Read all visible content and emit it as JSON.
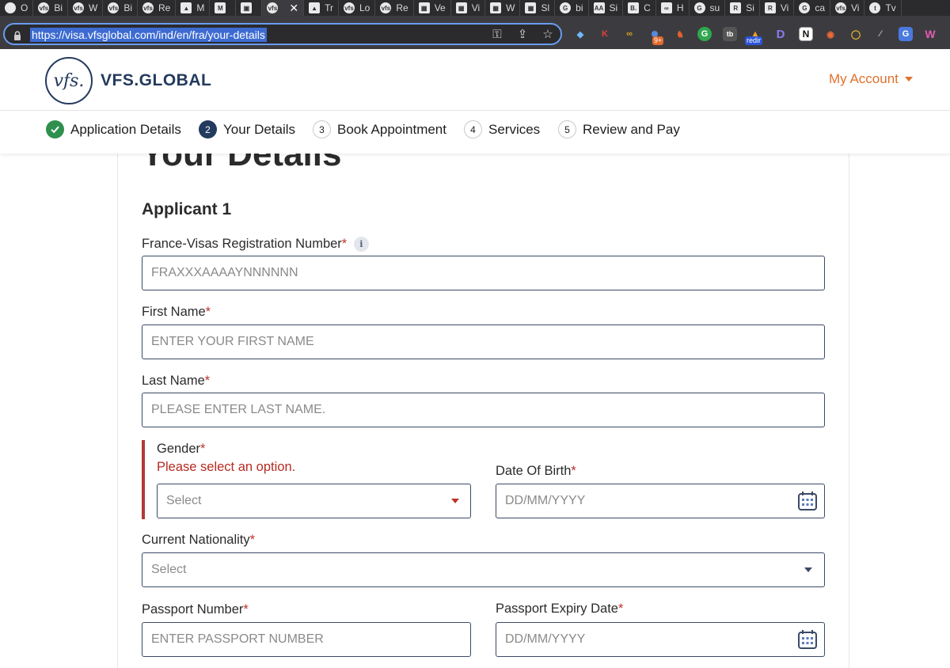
{
  "browser": {
    "tabs": [
      {
        "label": "O",
        "fav": "",
        "kind": "round"
      },
      {
        "label": "Bi",
        "fav": "vfs",
        "kind": "round"
      },
      {
        "label": "W",
        "fav": "vfs",
        "kind": "round"
      },
      {
        "label": "Bi",
        "fav": "vfs",
        "kind": "round"
      },
      {
        "label": "Re",
        "fav": "vfs",
        "kind": "round"
      },
      {
        "label": "M",
        "fav": "▲",
        "kind": "sq"
      },
      {
        "label": "",
        "fav": "M",
        "kind": "sq"
      },
      {
        "label": "",
        "fav": "▣",
        "kind": "sq"
      },
      {
        "label": "",
        "fav": "vfs",
        "kind": "round",
        "active": true
      },
      {
        "label": "Tr",
        "fav": "▲",
        "kind": "sq"
      },
      {
        "label": "Lo",
        "fav": "vfs",
        "kind": "round"
      },
      {
        "label": "Re",
        "fav": "vfs",
        "kind": "round"
      },
      {
        "label": "Ve",
        "fav": "▦",
        "kind": "sq"
      },
      {
        "label": "Vi",
        "fav": "▦",
        "kind": "sq"
      },
      {
        "label": "W",
        "fav": "▦",
        "kind": "sq"
      },
      {
        "label": "Sl",
        "fav": "▦",
        "kind": "sq"
      },
      {
        "label": "bi",
        "fav": "G",
        "kind": "round"
      },
      {
        "label": "Si",
        "fav": "AA",
        "kind": "sq"
      },
      {
        "label": "C",
        "fav": "B.",
        "kind": "sq"
      },
      {
        "label": "H",
        "fav": "∞",
        "kind": "sq"
      },
      {
        "label": "su",
        "fav": "G",
        "kind": "round"
      },
      {
        "label": "Si",
        "fav": "R",
        "kind": "sq"
      },
      {
        "label": "Vi",
        "fav": "R",
        "kind": "sq"
      },
      {
        "label": "ca",
        "fav": "G",
        "kind": "round"
      },
      {
        "label": "Vi",
        "fav": "vfs",
        "kind": "round"
      },
      {
        "label": "Tv",
        "fav": "t",
        "kind": "round"
      }
    ],
    "url": "https://visa.vfsglobal.com/ind/en/fra/your-details",
    "extensions": {
      "notif_badge": "9+",
      "redir_badge": "redir"
    },
    "colors": {
      "tab_bg": "#2b2b2e",
      "toolbar_bg": "#3c3c40",
      "url_highlight": "#3d6bd1"
    }
  },
  "header": {
    "logo_mark": "vfs.",
    "logo_text": "VFS.GLOBAL",
    "my_account": "My Account",
    "brand_color": "#243a5e",
    "accent_color": "#e0712e"
  },
  "stepper": [
    {
      "num": "1",
      "label": "Application Details",
      "state": "done"
    },
    {
      "num": "2",
      "label": "Your Details",
      "state": "current"
    },
    {
      "num": "3",
      "label": "Book Appointment",
      "state": "pending"
    },
    {
      "num": "4",
      "label": "Services",
      "state": "pending"
    },
    {
      "num": "5",
      "label": "Review and Pay",
      "state": "pending"
    }
  ],
  "form": {
    "page_title": "Your Details",
    "applicant_heading": "Applicant 1",
    "required_mark": "*",
    "info_glyph": "i",
    "fields": {
      "registration": {
        "label": "France-Visas Registration Number",
        "placeholder": "FRAXXXAAAAYNNNNNN"
      },
      "first_name": {
        "label": "First Name",
        "placeholder": "ENTER YOUR FIRST NAME"
      },
      "last_name": {
        "label": "Last Name",
        "placeholder": "PLEASE ENTER LAST NAME."
      },
      "gender": {
        "label": "Gender",
        "error": "Please select an option.",
        "value": "Select"
      },
      "dob": {
        "label": "Date Of Birth",
        "placeholder": "DD/MM/YYYY"
      },
      "nationality": {
        "label": "Current Nationality",
        "value": "Select"
      },
      "passport_number": {
        "label": "Passport Number",
        "placeholder": "ENTER PASSPORT NUMBER"
      },
      "passport_expiry": {
        "label": "Passport Expiry Date",
        "placeholder": "DD/MM/YYYY"
      }
    },
    "error_color": "#b72a22"
  }
}
